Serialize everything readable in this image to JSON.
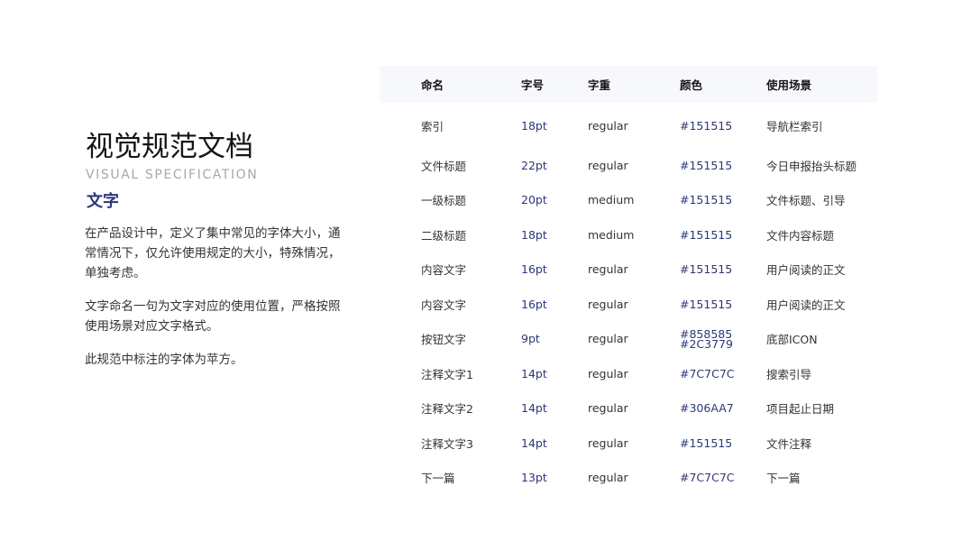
{
  "header": {
    "title": "视觉规范文档",
    "subtitle": "VISUAL SPECIFICATION"
  },
  "section": {
    "heading": "文字",
    "paragraphs": [
      "在产品设计中，定义了集中常见的字体大小，通常情况下，仅允许使用规定的大小，特殊情况，单独考虑。",
      "文字命名一句为文字对应的使用位置，严格按照使用场景对应文字格式。",
      "此规范中标注的字体为苹方。"
    ]
  },
  "table": {
    "columns": [
      "命名",
      "字号",
      "字重",
      "颜色",
      "使用场景"
    ],
    "rows": [
      {
        "name": "索引",
        "size": "18pt",
        "weight": "regular",
        "color": "#151515",
        "usage": "导航栏索引"
      },
      {
        "name": "文件标题",
        "size": "22pt",
        "weight": "regular",
        "color": "#151515",
        "usage": "今日申报抬头标题"
      },
      {
        "name": "一级标题",
        "size": "20pt",
        "weight": "medium",
        "color": "#151515",
        "usage": "文件标题、引导"
      },
      {
        "name": "二级标题",
        "size": "18pt",
        "weight": "medium",
        "color": "#151515",
        "usage": "文件内容标题"
      },
      {
        "name": "内容文字",
        "size": "16pt",
        "weight": "regular",
        "color": "#151515",
        "usage": "用户阅读的正文"
      },
      {
        "name": "内容文字",
        "size": "16pt",
        "weight": "regular",
        "color": "#151515",
        "usage": "用户阅读的正文"
      },
      {
        "name": "按钮文字",
        "size": "9pt",
        "weight": "regular",
        "color": "#858585",
        "color2": "#2C3779",
        "usage": "底部ICON"
      },
      {
        "name": "注释文字1",
        "size": "14pt",
        "weight": "regular",
        "color": "#7C7C7C",
        "usage": "搜索引导"
      },
      {
        "name": "注释文字2",
        "size": "14pt",
        "weight": "regular",
        "color": "#306AA7",
        "usage": "项目起止日期"
      },
      {
        "name": "注释文字3",
        "size": "14pt",
        "weight": "regular",
        "color": "#151515",
        "usage": "文件注释"
      },
      {
        "name": "下一篇",
        "size": "13pt",
        "weight": "regular",
        "color": "#7C7C7C",
        "usage": "下一篇"
      }
    ]
  },
  "theme": {
    "accent": "#2c3779",
    "header_bg": "#f7f8fc",
    "subtitle_color": "#a8a8a8"
  }
}
